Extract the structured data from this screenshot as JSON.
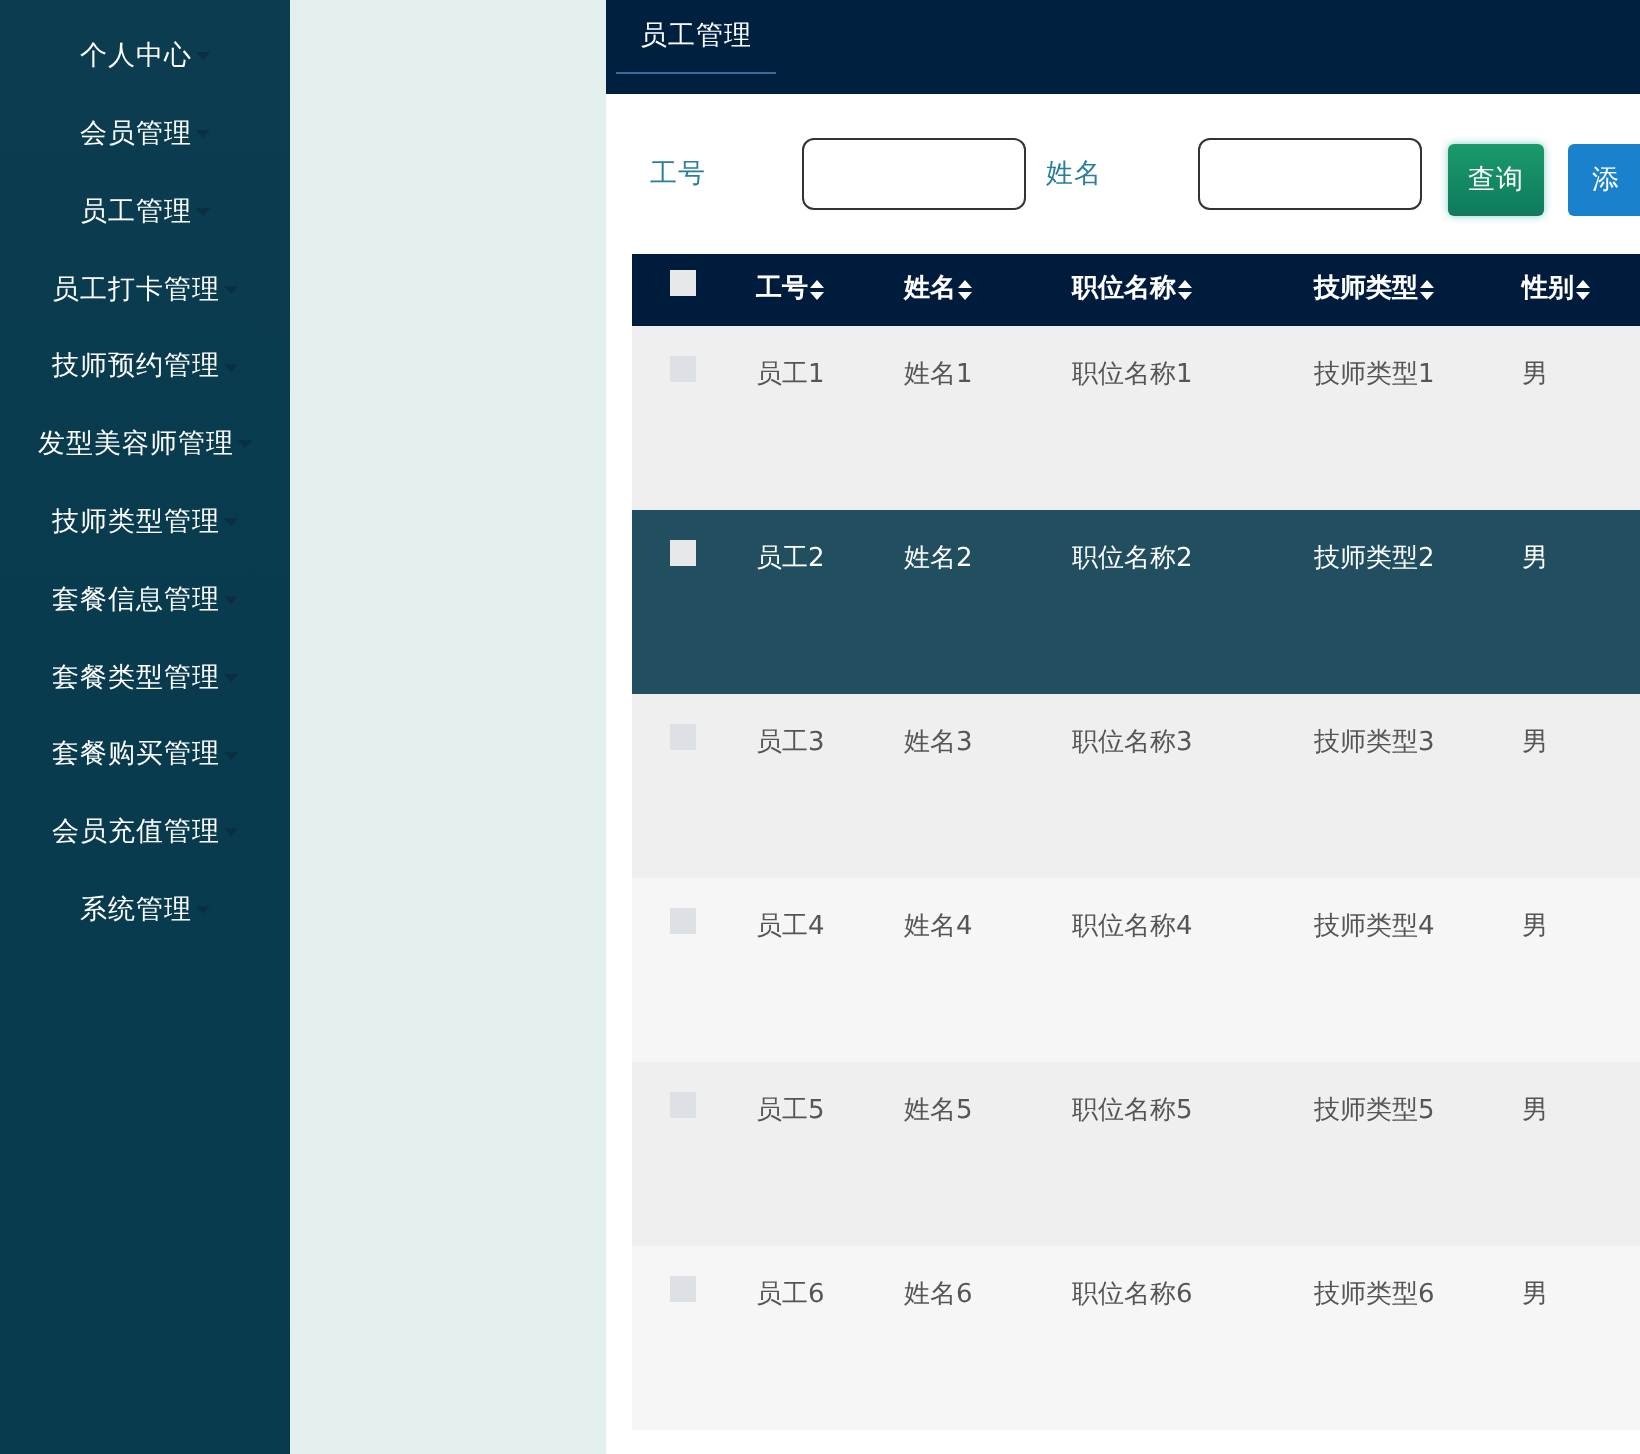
{
  "sidebar": {
    "items": [
      {
        "label": "个人中心"
      },
      {
        "label": "会员管理"
      },
      {
        "label": "员工管理"
      },
      {
        "label": "员工打卡管理"
      },
      {
        "label": "技师预约管理"
      },
      {
        "label": "发型美容师管理"
      },
      {
        "label": "技师类型管理"
      },
      {
        "label": "套餐信息管理"
      },
      {
        "label": "套餐类型管理"
      },
      {
        "label": "套餐购买管理"
      },
      {
        "label": "会员充值管理"
      },
      {
        "label": "系统管理"
      }
    ]
  },
  "tabs": [
    {
      "label": "员工管理",
      "selected": true
    }
  ],
  "search": {
    "fields": [
      {
        "label": "工号"
      },
      {
        "label": "姓名"
      }
    ],
    "buttons": [
      {
        "label": "查询",
        "kind": "query"
      },
      {
        "label": "添",
        "kind": "add"
      }
    ]
  },
  "table": {
    "select_all": {
      "checked": false
    },
    "columns": [
      "工号",
      "姓名",
      "职位名称",
      "技师类型",
      "性别"
    ],
    "rows": [
      {
        "cells": [
          "员工1",
          "姓名1",
          "职位名称1",
          "技师类型1",
          "男"
        ],
        "checked": false,
        "highlighted": false
      },
      {
        "cells": [
          "员工2",
          "姓名2",
          "职位名称2",
          "技师类型2",
          "男"
        ],
        "checked": false,
        "highlighted": true
      },
      {
        "cells": [
          "员工3",
          "姓名3",
          "职位名称3",
          "技师类型3",
          "男"
        ],
        "checked": false,
        "highlighted": false
      },
      {
        "cells": [
          "员工4",
          "姓名4",
          "职位名称4",
          "技师类型4",
          "男"
        ],
        "checked": false,
        "highlighted": false
      },
      {
        "cells": [
          "员工5",
          "姓名5",
          "职位名称5",
          "技师类型5",
          "男"
        ],
        "checked": false,
        "highlighted": false
      },
      {
        "cells": [
          "员工6",
          "姓名6",
          "职位名称6",
          "技师类型6",
          "男"
        ],
        "checked": false,
        "highlighted": false
      }
    ]
  }
}
